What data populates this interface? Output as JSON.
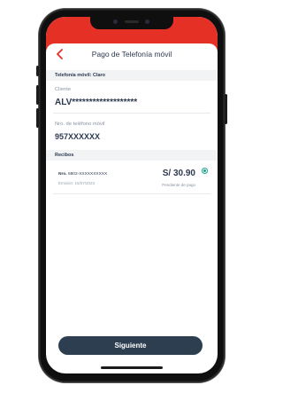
{
  "header": {
    "title": "Pago de Telefonía móvil"
  },
  "phone_section": {
    "label": "Telefonía móvil: Claro"
  },
  "client": {
    "label": "Cliente",
    "value": "ALV*******************"
  },
  "phone_number": {
    "label": "Nro. de teléfono móvil",
    "value": "957XXXXXX"
  },
  "receipts_section": {
    "label": "Recibos"
  },
  "receipt": {
    "number_prefix": "Nro. ",
    "number": "5802-XXXXXXXXXX",
    "emission": "Emisión: 15/07/2023",
    "amount": "S/ 30.90",
    "status": "Pendiente de pago",
    "selected": true
  },
  "footer": {
    "next_label": "Siguiente"
  },
  "colors": {
    "brand_red": "#e53025",
    "button": "#2c3e50",
    "radio": "#19a38b"
  }
}
